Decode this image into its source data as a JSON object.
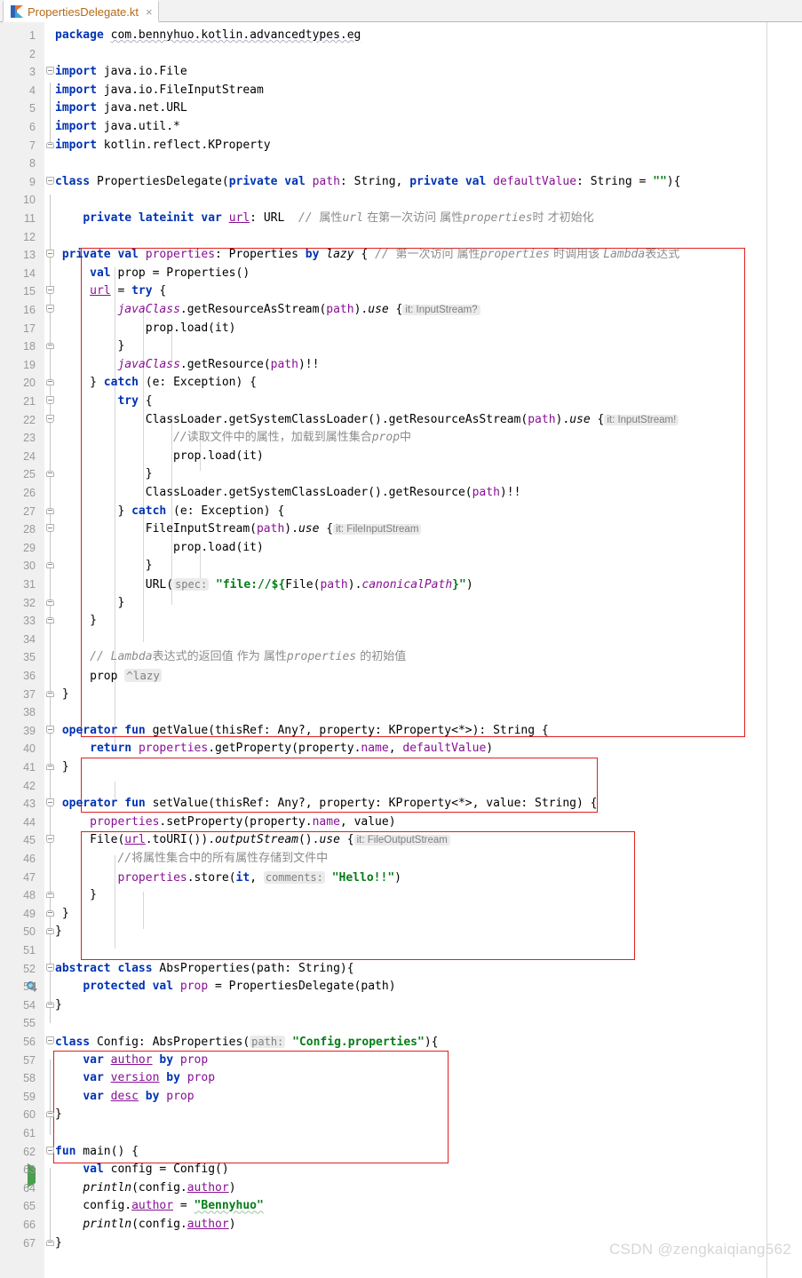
{
  "window": {
    "app": "IntelliJ IDEA Editor",
    "watermark": "CSDN @zengkaiqiang562"
  },
  "tab": {
    "label": "PropertiesDelegate.kt",
    "close_label": "×",
    "icon": "kotlin-file-icon"
  },
  "editor": {
    "language": "Kotlin",
    "first_line": 1,
    "last_line": 67,
    "gutter_icons": [
      {
        "line": 52,
        "icon": "implemented-by-icon"
      },
      {
        "line": 62,
        "icon": "run-main-icon"
      }
    ],
    "colors": {
      "keyword": "#0033b3",
      "string": "#067d17",
      "comment": "#8c8c8c",
      "field": "#871094",
      "annotation_box": "#e02020",
      "gutter_bg": "#f0f0f0",
      "line_number": "#999999",
      "tab_label": "#b56a17",
      "watermark": "#d6d6d6"
    },
    "annotation_boxes": [
      {
        "name": "properties-lazy-delegate-box",
        "from_line": 13,
        "to_line": 37
      },
      {
        "name": "get-value-operator-box",
        "from_line": 39,
        "to_line": 41
      },
      {
        "name": "set-value-operator-box",
        "from_line": 43,
        "to_line": 49
      },
      {
        "name": "config-class-box",
        "from_line": 56,
        "to_line": 60
      }
    ],
    "lines": [
      {
        "n": 1,
        "text": "package com.bennyhuo.kotlin.advancedtypes.eg"
      },
      {
        "n": 2,
        "text": ""
      },
      {
        "n": 3,
        "text": "import java.io.File"
      },
      {
        "n": 4,
        "text": "import java.io.FileInputStream"
      },
      {
        "n": 5,
        "text": "import java.net.URL"
      },
      {
        "n": 6,
        "text": "import java.util.*"
      },
      {
        "n": 7,
        "text": "import kotlin.reflect.KProperty"
      },
      {
        "n": 8,
        "text": ""
      },
      {
        "n": 9,
        "text": "class PropertiesDelegate(private val path: String, private val defaultValue: String = \"\"){"
      },
      {
        "n": 10,
        "text": ""
      },
      {
        "n": 11,
        "text": "    private lateinit var url: URL  // 属性url 在第一次访问 属性properties时 才初始化"
      },
      {
        "n": 12,
        "text": ""
      },
      {
        "n": 13,
        "text": "    private val properties: Properties by lazy { // 第一次访问 属性properties 时调用该 Lambda表达式"
      },
      {
        "n": 14,
        "text": "        val prop = Properties()"
      },
      {
        "n": 15,
        "text": "        url = try {"
      },
      {
        "n": 16,
        "text": "            javaClass.getResourceAsStream(path).use { it: InputStream?"
      },
      {
        "n": 17,
        "text": "                prop.load(it)"
      },
      {
        "n": 18,
        "text": "            }"
      },
      {
        "n": 19,
        "text": "            javaClass.getResource(path)!!"
      },
      {
        "n": 20,
        "text": "        } catch (e: Exception) {"
      },
      {
        "n": 21,
        "text": "            try {"
      },
      {
        "n": 22,
        "text": "                ClassLoader.getSystemClassLoader().getResourceAsStream(path).use { it: InputStream!"
      },
      {
        "n": 23,
        "text": "                    //读取文件中的属性，加载到属性集合prop中"
      },
      {
        "n": 24,
        "text": "                    prop.load(it)"
      },
      {
        "n": 25,
        "text": "                }"
      },
      {
        "n": 26,
        "text": "                ClassLoader.getSystemClassLoader().getResource(path)!!"
      },
      {
        "n": 27,
        "text": "            } catch (e: Exception) {"
      },
      {
        "n": 28,
        "text": "                FileInputStream(path).use { it: FileInputStream"
      },
      {
        "n": 29,
        "text": "                    prop.load(it)"
      },
      {
        "n": 30,
        "text": "                }"
      },
      {
        "n": 31,
        "text": "                URL( spec: \"file://${File(path).canonicalPath}\")"
      },
      {
        "n": 32,
        "text": "            }"
      },
      {
        "n": 33,
        "text": "        }"
      },
      {
        "n": 34,
        "text": ""
      },
      {
        "n": 35,
        "text": "        // Lambda表达式的返回值 作为 属性properties 的初始值"
      },
      {
        "n": 36,
        "text": "        prop ^lazy"
      },
      {
        "n": 37,
        "text": "    }"
      },
      {
        "n": 38,
        "text": ""
      },
      {
        "n": 39,
        "text": "    operator fun getValue(thisRef: Any?, property: KProperty<*>): String {"
      },
      {
        "n": 40,
        "text": "        return properties.getProperty(property.name, defaultValue)"
      },
      {
        "n": 41,
        "text": "    }"
      },
      {
        "n": 42,
        "text": ""
      },
      {
        "n": 43,
        "text": "    operator fun setValue(thisRef: Any?, property: KProperty<*>, value: String) {"
      },
      {
        "n": 44,
        "text": "        properties.setProperty(property.name, value)"
      },
      {
        "n": 45,
        "text": "        File(url.toURI()).outputStream().use { it: FileOutputStream"
      },
      {
        "n": 46,
        "text": "            //将属性集合中的所有属性存储到文件中"
      },
      {
        "n": 47,
        "text": "            properties.store(it, comments: \"Hello!!\")"
      },
      {
        "n": 48,
        "text": "        }"
      },
      {
        "n": 49,
        "text": "    }"
      },
      {
        "n": 50,
        "text": "}"
      },
      {
        "n": 51,
        "text": ""
      },
      {
        "n": 52,
        "text": "abstract class AbsProperties(path: String){"
      },
      {
        "n": 53,
        "text": "    protected val prop = PropertiesDelegate(path)"
      },
      {
        "n": 54,
        "text": "}"
      },
      {
        "n": 55,
        "text": ""
      },
      {
        "n": 56,
        "text": "class Config: AbsProperties( path: \"Config.properties\"){"
      },
      {
        "n": 57,
        "text": "    var author by prop"
      },
      {
        "n": 58,
        "text": "    var version by prop"
      },
      {
        "n": 59,
        "text": "    var desc by prop"
      },
      {
        "n": 60,
        "text": "}"
      },
      {
        "n": 61,
        "text": ""
      },
      {
        "n": 62,
        "text": "fun main() {"
      },
      {
        "n": 63,
        "text": "    val config = Config()"
      },
      {
        "n": 64,
        "text": "    println(config.author)"
      },
      {
        "n": 65,
        "text": "    config.author = \"Bennyhuo\""
      },
      {
        "n": 66,
        "text": "    println(config.author)"
      },
      {
        "n": 67,
        "text": "}"
      }
    ],
    "inlay_hints": [
      {
        "line": 16,
        "text": "it: InputStream?"
      },
      {
        "line": 22,
        "text": "it: InputStream!"
      },
      {
        "line": 28,
        "text": "it: FileInputStream"
      },
      {
        "line": 31,
        "text": "spec:"
      },
      {
        "line": 36,
        "text": "^lazy"
      },
      {
        "line": 45,
        "text": "it: FileOutputStream"
      },
      {
        "line": 47,
        "text": "comments:"
      },
      {
        "line": 56,
        "text": "path:"
      }
    ]
  }
}
